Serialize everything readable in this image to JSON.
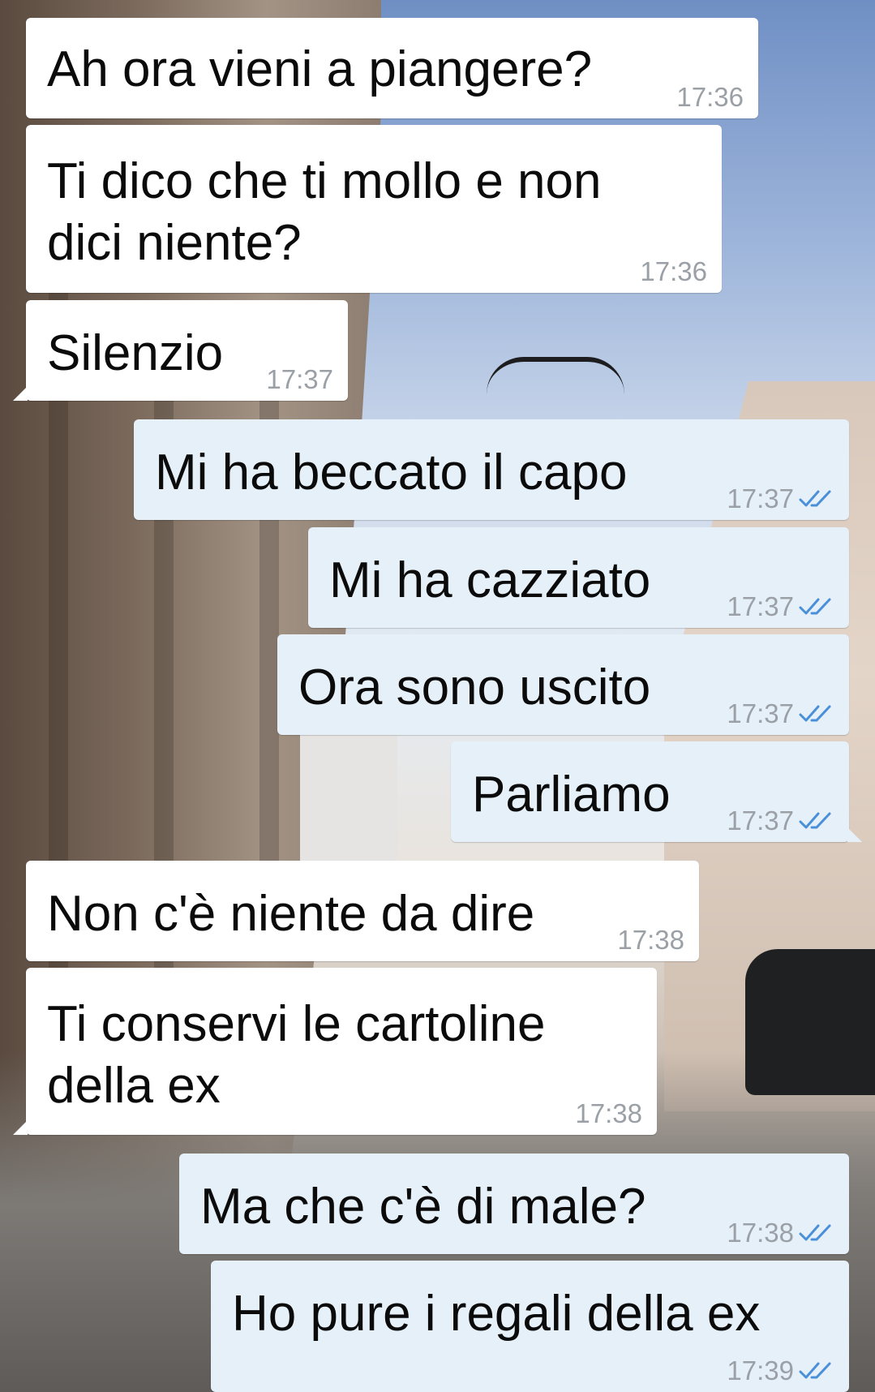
{
  "colors": {
    "incoming_bubble": "#ffffff",
    "outgoing_bubble": "#e6f0f9",
    "read_ticks": "#4a90d9",
    "timestamp": "#9aa0a6"
  },
  "messages": [
    {
      "direction": "incoming",
      "text": "Ah ora vieni a piangere?",
      "time": "17:36"
    },
    {
      "direction": "incoming",
      "text": "Ti dico che ti mollo e non\ndici niente?",
      "time": "17:36"
    },
    {
      "direction": "incoming",
      "text": "Silenzio",
      "time": "17:37"
    },
    {
      "direction": "outgoing",
      "text": "Mi ha beccato il capo",
      "time": "17:37",
      "status_icon": "double-check-read-icon"
    },
    {
      "direction": "outgoing",
      "text": "Mi ha cazziato",
      "time": "17:37",
      "status_icon": "double-check-read-icon"
    },
    {
      "direction": "outgoing",
      "text": "Ora sono uscito",
      "time": "17:37",
      "status_icon": "double-check-read-icon"
    },
    {
      "direction": "outgoing",
      "text": "Parliamo",
      "time": "17:37",
      "status_icon": "double-check-read-icon"
    },
    {
      "direction": "incoming",
      "text": "Non c'è niente da dire",
      "time": "17:38"
    },
    {
      "direction": "incoming",
      "text": "Ti conservi le cartoline\ndella ex",
      "time": "17:38"
    },
    {
      "direction": "outgoing",
      "text": "Ma che c'è di male?",
      "time": "17:38",
      "status_icon": "double-check-read-icon"
    },
    {
      "direction": "outgoing",
      "text": "Ho pure i regali della ex",
      "time": "17:39",
      "status_icon": "double-check-read-icon"
    }
  ]
}
